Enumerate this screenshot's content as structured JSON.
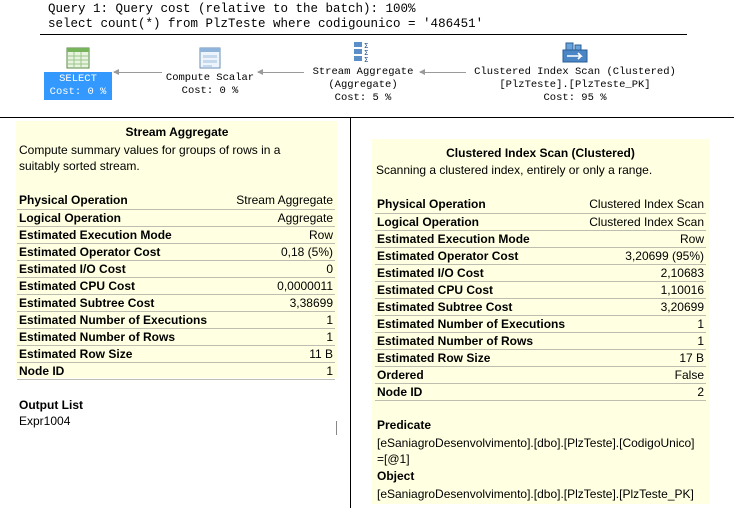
{
  "query": {
    "cost_line": "Query 1: Query cost (relative to the batch): 100%",
    "sql_line": "select count(*) from PlzTeste where codigounico = '486451'"
  },
  "plan": {
    "select": {
      "label": "SELECT",
      "cost": "Cost: 0 %"
    },
    "compute_scalar": {
      "label": "Compute Scalar",
      "cost": "Cost: 0 %"
    },
    "stream_aggregate": {
      "label": "Stream Aggregate",
      "sub": "(Aggregate)",
      "cost": "Cost: 5 %"
    },
    "clustered_scan": {
      "label": "Clustered Index Scan (Clustered)",
      "sub": "[PlzTeste].[PlzTeste_PK]",
      "cost": "Cost: 95 %"
    }
  },
  "stream_tooltip": {
    "title": "Stream Aggregate",
    "description_line1": "Compute summary values for groups of rows in a",
    "description_line2": "suitably sorted stream.",
    "properties": [
      {
        "name": "Physical Operation",
        "value": "Stream Aggregate"
      },
      {
        "name": "Logical Operation",
        "value": "Aggregate"
      },
      {
        "name": "Estimated Execution Mode",
        "value": "Row"
      },
      {
        "name": "Estimated Operator Cost",
        "value": "0,18 (5%)"
      },
      {
        "name": "Estimated I/O Cost",
        "value": "0"
      },
      {
        "name": "Estimated CPU Cost",
        "value": "0,0000011"
      },
      {
        "name": "Estimated Subtree Cost",
        "value": "3,38699"
      },
      {
        "name": "Estimated Number of Executions",
        "value": "1"
      },
      {
        "name": "Estimated Number of Rows",
        "value": "1"
      },
      {
        "name": "Estimated Row Size",
        "value": "11 B"
      },
      {
        "name": "Node ID",
        "value": "1"
      }
    ],
    "output_list_label": "Output List",
    "output_list_value": "Expr1004"
  },
  "scan_tooltip": {
    "title": "Clustered Index Scan (Clustered)",
    "description": "Scanning a clustered index, entirely or only a range.",
    "properties": [
      {
        "name": "Physical Operation",
        "value": "Clustered Index Scan"
      },
      {
        "name": "Logical Operation",
        "value": "Clustered Index Scan"
      },
      {
        "name": "Estimated Execution Mode",
        "value": "Row"
      },
      {
        "name": "Estimated Operator Cost",
        "value": "3,20699 (95%)"
      },
      {
        "name": "Estimated I/O Cost",
        "value": "2,10683"
      },
      {
        "name": "Estimated CPU Cost",
        "value": "1,10016"
      },
      {
        "name": "Estimated Subtree Cost",
        "value": "3,20699"
      },
      {
        "name": "Estimated Number of Executions",
        "value": "1"
      },
      {
        "name": "Estimated Number of Rows",
        "value": "1"
      },
      {
        "name": "Estimated Row Size",
        "value": "17 B"
      },
      {
        "name": "Ordered",
        "value": "False"
      },
      {
        "name": "Node ID",
        "value": "2"
      }
    ],
    "predicate_label": "Predicate",
    "predicate_line1": "[eSaniagroDesenvolvimento].[dbo].[PlzTeste].[CodigoUnico]",
    "predicate_line2": "=[@1]",
    "object_label": "Object",
    "object_value": "[eSaniagroDesenvolvimento].[dbo].[PlzTeste].[PlzTeste_PK]"
  },
  "colors": {
    "tooltip_bg": "#ffffe1",
    "selected_bg": "#3399ff",
    "row_border": "#bdbdb0"
  },
  "icons": {
    "select": "result-grid-icon",
    "compute_scalar": "compute-scalar-icon",
    "stream_aggregate": "stream-aggregate-icon",
    "clustered_scan": "clustered-index-scan-icon"
  }
}
